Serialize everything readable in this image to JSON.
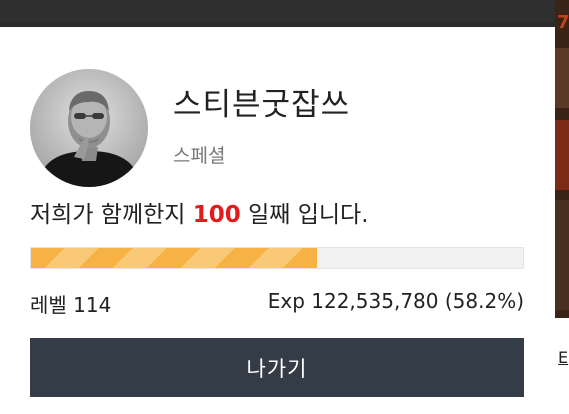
{
  "profile": {
    "nickname": "스티븐굿잡쓰",
    "grade": "스페셜",
    "days_prefix": "저희가 함께한지 ",
    "days_count": "100",
    "days_suffix": " 일째 입니다."
  },
  "progress": {
    "level_text": "레벨 114",
    "exp_text": "Exp 122,535,780 (58.2%)",
    "percent": 58.2,
    "fill_color": "#f6b245"
  },
  "actions": {
    "exit_label": "나가기"
  },
  "colors": {
    "days_highlight": "#e21b1b",
    "button_bg": "#343c47"
  },
  "background": {
    "right_edge_glyph": "7",
    "right_edge_link": "E"
  }
}
